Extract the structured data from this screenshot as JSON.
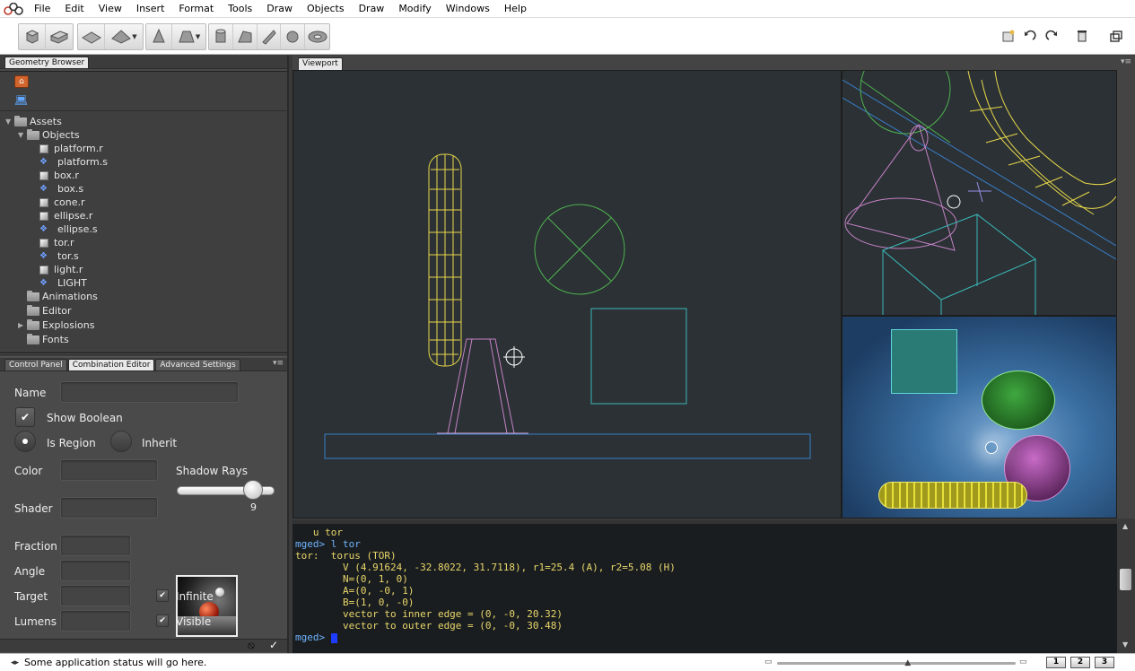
{
  "menu": [
    "File",
    "Edit",
    "View",
    "Insert",
    "Format",
    "Tools",
    "Draw",
    "Objects",
    "Draw",
    "Modify",
    "Windows",
    "Help"
  ],
  "geometry_browser": {
    "tab": "Geometry Browser",
    "tree": [
      {
        "label": "Assets",
        "level": 0,
        "kind": "folder",
        "expanded": true
      },
      {
        "label": "Objects",
        "level": 1,
        "kind": "folder",
        "expanded": true
      },
      {
        "label": "platform.r",
        "level": 2,
        "kind": "region"
      },
      {
        "label": "platform.s",
        "level": 3,
        "kind": "solid"
      },
      {
        "label": "box.r",
        "level": 2,
        "kind": "region"
      },
      {
        "label": "box.s",
        "level": 3,
        "kind": "solid"
      },
      {
        "label": "cone.r",
        "level": 2,
        "kind": "region"
      },
      {
        "label": "ellipse.r",
        "level": 2,
        "kind": "region"
      },
      {
        "label": "ellipse.s",
        "level": 3,
        "kind": "solid"
      },
      {
        "label": "tor.r",
        "level": 2,
        "kind": "region"
      },
      {
        "label": "tor.s",
        "level": 3,
        "kind": "solid"
      },
      {
        "label": "light.r",
        "level": 2,
        "kind": "region"
      },
      {
        "label": "LIGHT",
        "level": 3,
        "kind": "solid"
      },
      {
        "label": "Animations",
        "level": 1,
        "kind": "folder"
      },
      {
        "label": "Editor",
        "level": 1,
        "kind": "folder"
      },
      {
        "label": "Explosions",
        "level": 1,
        "kind": "folder",
        "collapsed": true
      },
      {
        "label": "Fonts",
        "level": 1,
        "kind": "folder"
      }
    ]
  },
  "panel_tabs": {
    "control": "Control Panel",
    "combination": "Combination Editor",
    "advanced": "Advanced Settings"
  },
  "combo_editor": {
    "name_label": "Name",
    "name_value": "",
    "show_boolean": "Show Boolean",
    "is_region": "Is Region",
    "inherit": "Inherit",
    "color": "Color",
    "shadow_rays": "Shadow Rays",
    "shadow_rays_value": "9",
    "shadow_rays_level": 0.78,
    "shader": "Shader",
    "fraction": "Fraction",
    "angle": "Angle",
    "target": "Target",
    "lumens": "Lumens",
    "infinite": "Infinite",
    "visible": "Visible"
  },
  "viewport": {
    "tab": "Viewport"
  },
  "console": {
    "lines": [
      {
        "text": "   u tor",
        "cls": "cy"
      },
      {
        "text": "mged> l tor",
        "cls": "cp"
      },
      {
        "text": "tor:  torus (TOR)",
        "cls": "cy"
      },
      {
        "text": "        V (4.91624, -32.8022, 31.7118), r1=25.4 (A), r2=5.08 (H)",
        "cls": "cy"
      },
      {
        "text": "        N=(0, 1, 0)",
        "cls": "cy"
      },
      {
        "text": "        A=(0, -0, 1)",
        "cls": "cy"
      },
      {
        "text": "        B=(1, 0, -0)",
        "cls": "cy"
      },
      {
        "text": "        vector to inner edge = (0, -0, 20.32)",
        "cls": "cy"
      },
      {
        "text": "        vector to outer edge = (0, -0, 30.48)",
        "cls": "cy"
      }
    ],
    "prompt": "mged>"
  },
  "status": {
    "text": "Some application status will go here.",
    "zoom_level": 0.55
  },
  "layout_buttons": [
    "1",
    "2",
    "3"
  ]
}
